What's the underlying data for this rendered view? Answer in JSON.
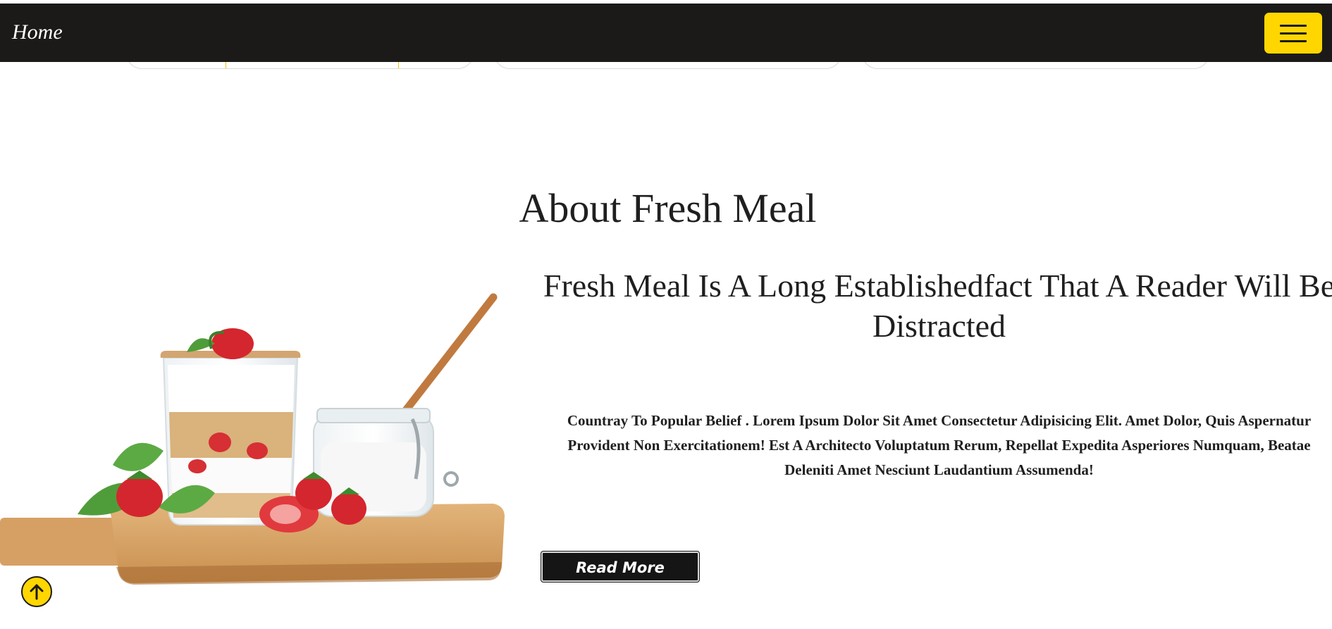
{
  "navbar": {
    "brand": "Home",
    "menu_toggle": "hamburger-menu-icon",
    "accent_color": "#ffd600",
    "background_color": "#1c1a18"
  },
  "about": {
    "title": "About Fresh Meal",
    "subtitle": "Fresh Meal Is A Long Establishedfact That A Reader Will Be Distracted",
    "paragraph": "Countray To Popular Belief . Lorem Ipsum Dolor Sit Amet Consectetur Adipisicing Elit. Amet Dolor, Quis Aspernatur Provident Non Exercitationem! Est A Architecto Voluptatum Rerum, Repellat Expedita Asperiores Numquam, Beatae Deleniti Amet Nesciunt Laudantium Assumenda!",
    "button_label": "Read More",
    "image": "yogurt-parfait-with-strawberries-on-wooden-board"
  },
  "back_to_top": {
    "icon": "arrow-up-icon"
  }
}
